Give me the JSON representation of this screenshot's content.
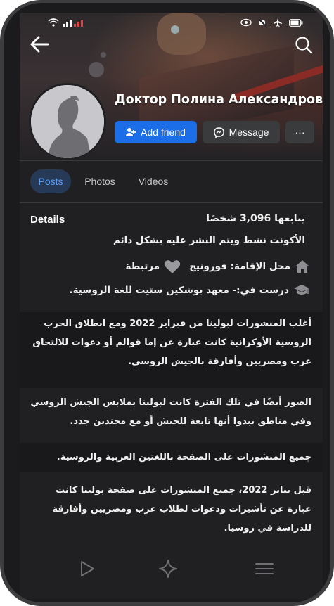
{
  "profile": {
    "name": "Доктор Полина Александровна",
    "add_friend_label": "Add friend",
    "message_label": "Message",
    "more_label": "···"
  },
  "tabs": [
    {
      "label": "Posts",
      "selected": true
    },
    {
      "label": "Photos",
      "selected": false
    },
    {
      "label": "Videos",
      "selected": false
    }
  ],
  "details": {
    "title": "Details",
    "followers": "يتابعها 3,096 شخصًا",
    "active_note": "الأكونت نشط ويتم النشر عليه بشكل دائم",
    "residence": "محل الإقامة: فورونيج",
    "relationship": "مرتبطة",
    "studied": "درست في:- معهد بوشكين ستيت للغة الروسية."
  },
  "notes": [
    "أغلب المنشورات لبولينا من فبراير 2022 ومع انطلاق الحرب الروسية الأوكرانية كانت عبارة عن إما قوالم أو دعوات للالتحاق عرب ومصريين وأفارقة بالجيش الروسي.",
    "الصور أيضًا في تلك الفترة كانت لبولينا بملابس الجيش الروسي وفي مناطق يبدوا أنها تابعة للجيش أو مع مجندين جدد.",
    "جميع المنشورات على الصفحة باللغتين العربية والروسية.",
    "قبل يناير 2022، جميع المنشورات على صفحة بولينا كانت عبارة عن تأشيرات ودعوات لطلاب عرب ومصريين وأفارقة للدراسة في روسيا."
  ],
  "colors": {
    "accent": "#1b6ee8",
    "tab_selected_bg": "#263a57",
    "tab_selected_text": "#5ea0f5",
    "background": "#202022"
  },
  "icons": {
    "back": "arrow-left-icon",
    "search": "search-icon",
    "add_friend": "add-person-icon",
    "message": "messenger-icon",
    "home": "home-icon",
    "heart": "heart-icon",
    "study": "graduation-cap-icon",
    "nav": [
      "play-icon",
      "sparkle-icon",
      "menu-icon"
    ]
  }
}
